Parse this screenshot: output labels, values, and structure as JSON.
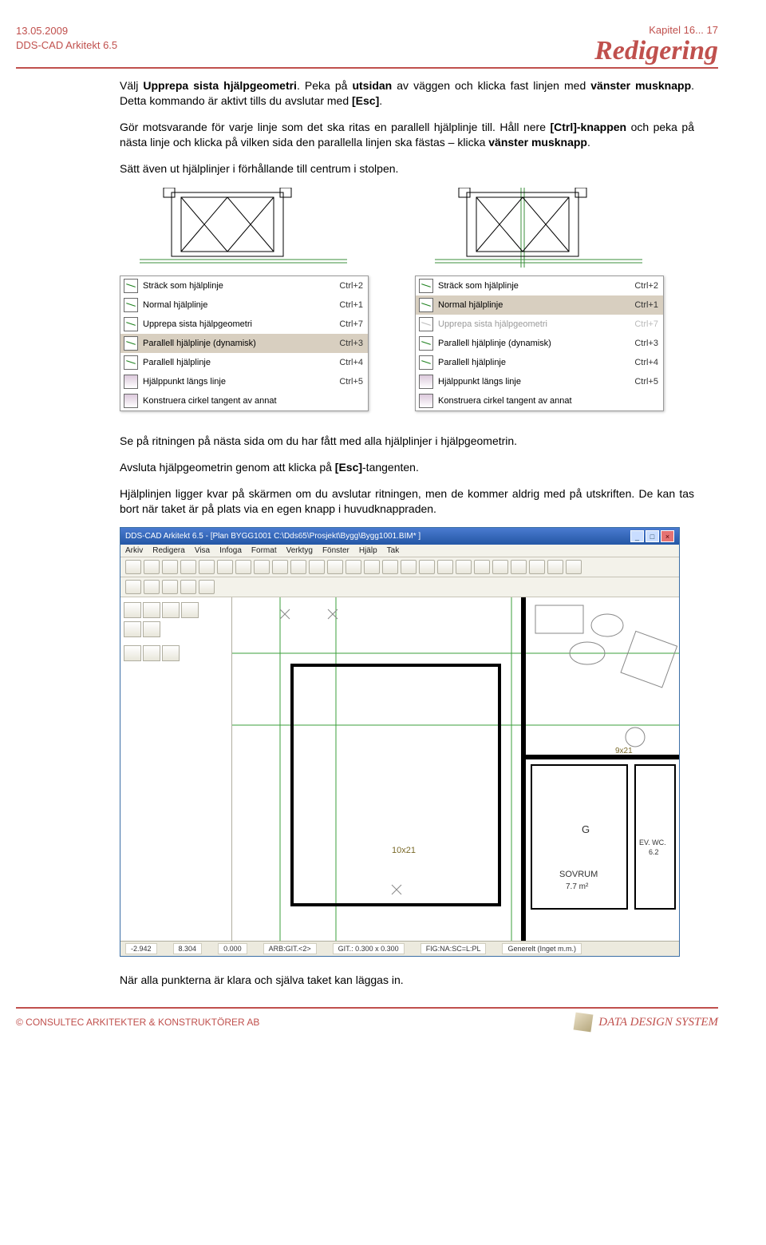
{
  "header": {
    "date": "13.05.2009",
    "product": "DDS-CAD Arkitekt 6.5",
    "chapter": "Kapitel 16... 17",
    "section_title": "Redigering"
  },
  "paragraphs": {
    "p1_a": "Välj ",
    "p1_b": "Upprepa sista hjälpgeometri",
    "p1_c": ". Peka på ",
    "p1_d": "utsidan",
    "p1_e": " av väggen och klicka fast linjen med ",
    "p1_f": "vänster musknapp",
    "p1_g": ". Detta kommando är aktivt tills du avslutar med ",
    "p1_h": "[Esc]",
    "p1_i": ".",
    "p2_a": "Gör motsvarande för varje linje som det ska ritas en parallell hjälplinje till. Håll nere ",
    "p2_b": "[Ctrl]-knappen",
    "p2_c": " och peka på nästa linje och klicka på vilken sida den parallella linjen ska fästas – klicka ",
    "p2_d": "vänster musknapp",
    "p2_e": ".",
    "p3": "Sätt även ut hjälplinjer i förhållande till centrum i stolpen.",
    "p4": "Se på ritningen på nästa sida om du har fått med alla hjälplinjer i hjälpgeometrin.",
    "p5_a": "Avsluta hjälpgeometrin genom att klicka på ",
    "p5_b": "[Esc]",
    "p5_c": "-tangenten.",
    "p6": "Hjälplinjen ligger kvar på skärmen om du avslutar ritningen, men de kommer aldrig med på utskriften. De kan tas bort när taket är på plats via en egen knapp i huvudknappraden.",
    "p7": "När alla punkterna är klara och själva taket kan läggas in."
  },
  "context_menu": {
    "items": [
      {
        "label": "Sträck som hjälplinje",
        "shortcut": "Ctrl+2",
        "highlight_left": false,
        "highlight_right": false,
        "disabled_right": false
      },
      {
        "label": "Normal hjälplinje",
        "shortcut": "Ctrl+1",
        "highlight_left": false,
        "highlight_right": true,
        "disabled_right": false
      },
      {
        "label": "Upprepa sista hjälpgeometri",
        "shortcut": "Ctrl+7",
        "highlight_left": false,
        "highlight_right": false,
        "disabled_right": true
      },
      {
        "label": "Parallell hjälplinje (dynamisk)",
        "shortcut": "Ctrl+3",
        "highlight_left": true,
        "highlight_right": false,
        "disabled_right": false
      },
      {
        "label": "Parallell hjälplinje",
        "shortcut": "Ctrl+4",
        "highlight_left": false,
        "highlight_right": false,
        "disabled_right": false
      },
      {
        "label": "Hjälppunkt längs linje",
        "shortcut": "Ctrl+5",
        "highlight_left": false,
        "highlight_right": false,
        "disabled_right": false
      },
      {
        "label": "Konstruera cirkel tangent av annat",
        "shortcut": "",
        "highlight_left": false,
        "highlight_right": false,
        "disabled_right": false
      }
    ]
  },
  "app": {
    "title": "DDS-CAD Arkitekt 6.5 - [Plan  BYGG1001  C:\\Dds65\\Prosjekt\\Bygg\\Bygg1001.BIM* ]",
    "menus": [
      "Arkiv",
      "Redigera",
      "Visa",
      "Infoga",
      "Format",
      "Verktyg",
      "Fönster",
      "Hjälp",
      "Tak"
    ],
    "status": {
      "x": "-2.942",
      "y": "8.304",
      "z": "0.000",
      "arb": "ARB:GIT.<2>",
      "git": "GIT.: 0.300 x 0.300",
      "fig": "FIG:NA:SC=L:PL",
      "plan": "Generelt (Inget m.m.)"
    },
    "labels": {
      "room1": "10x21",
      "room2": "9x21",
      "g": "G",
      "sovrum": "SOVRUM",
      "sovrum_area": "7.7  m²",
      "ev_wc": "EV. WC.",
      "ev_wc_area": "6.2"
    }
  },
  "footer": {
    "left": "© CONSULTEC ARKITEKTER & KONSTRUKTÖRER AB",
    "right": "DATA DESIGN SYSTEM"
  }
}
